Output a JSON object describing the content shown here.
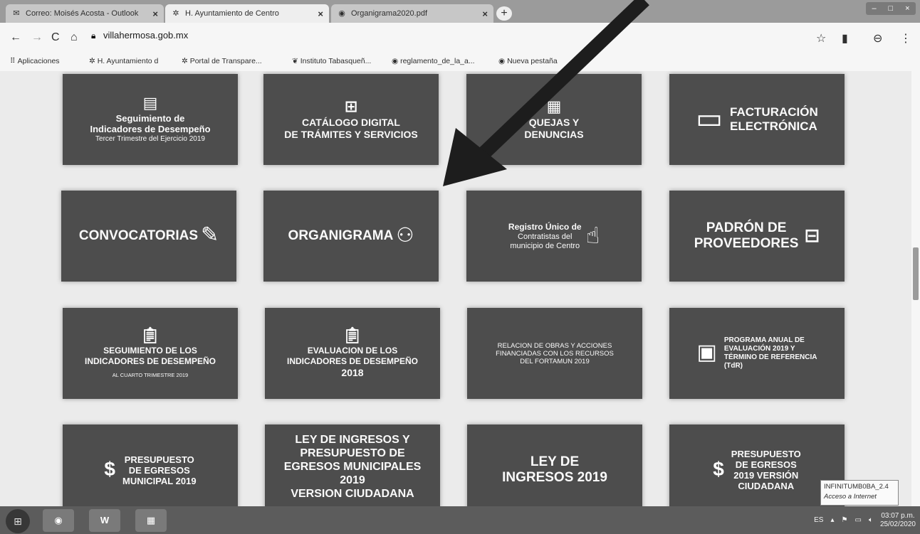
{
  "tabs": [
    {
      "label": "Correo: Moisés Acosta - Outlook",
      "icon": "outlook-icon",
      "close": "×"
    },
    {
      "label": "H. Ayuntamiento de Centro",
      "icon": "palm-icon",
      "close": "×"
    },
    {
      "label": "Organigrama2020.pdf",
      "icon": "globe-icon",
      "close": "×"
    }
  ],
  "new_tab": "+",
  "window_controls": {
    "minimize": "–",
    "maximize": "□",
    "close": "×"
  },
  "toolbar": {
    "back": "←",
    "forward": "→",
    "reload": "C",
    "home": "⌂",
    "url": "villahermosa.gob.mx",
    "star": "☆",
    "account": "⊖",
    "menu": "⋮"
  },
  "bookmarks": [
    {
      "label": "Aplicaciones",
      "icon": "apps-icon"
    },
    {
      "label": "H. Ayuntamiento d",
      "icon": "palm-icon"
    },
    {
      "label": "Portal de Transpare...",
      "icon": "palm-icon"
    },
    {
      "label": "Instituto Tabasqueñ...",
      "icon": "leaf-icon"
    },
    {
      "label": "reglamento_de_la_a...",
      "icon": "globe-icon"
    },
    {
      "label": "Nueva pestaña",
      "icon": "globe-icon"
    }
  ],
  "tiles": {
    "r1c1": {
      "l1": "Seguimiento de",
      "l2": "Indicadores de Desempeño",
      "l3": "Tercer Trimestre del Ejercicio 2019"
    },
    "r1c2": {
      "l1": "CATÁLOGO DIGITAL",
      "l2": "DE TRÁMITES Y SERVICIOS"
    },
    "r1c3": {
      "l1": "QUEJAS Y",
      "l2": "DENUNCIAS"
    },
    "r1c4": {
      "l1": "FACTURACIÓN",
      "l2": "ELECTRÓNICA"
    },
    "r2c1": {
      "l1": "CONVOCATORIAS"
    },
    "r2c2": {
      "l1": "ORGANIGRAMA"
    },
    "r2c3": {
      "l1": "Registro Único de",
      "l2": "Contratistas del",
      "l3": "municipio de Centro"
    },
    "r2c4": {
      "l1": "PADRÓN DE",
      "l2": "PROVEEDORES"
    },
    "r3c1": {
      "l1": "SEGUIMIENTO DE LOS",
      "l2": "INDICADORES DE DESEMPEÑO",
      "l3": "AL CUARTO TRIMESTRE 2019"
    },
    "r3c2": {
      "l1": "EVALUACION DE LOS",
      "l2": "INDICADORES DE DESEMPEÑO",
      "l3": "2018"
    },
    "r3c3": {
      "l1": "RELACION DE OBRAS Y ACCIONES",
      "l2": "FINANCIADAS CON LOS RECURSOS",
      "l3": "DEL FORTAMUN 2019"
    },
    "r3c4": {
      "l1": "PROGRAMA ANUAL DE",
      "l2": "EVALUACIÓN 2019 Y",
      "l3": "TÉRMINO DE REFERENCIA",
      "l4": "(TdR)"
    },
    "r4c1": {
      "l1": "PRESUPUESTO",
      "l2": "DE EGRESOS",
      "l3": "MUNICIPAL 2019"
    },
    "r4c2": {
      "l1": "LEY DE INGRESOS Y",
      "l2": "PRESUPUESTO DE",
      "l3": "EGRESOS MUNICIPALES",
      "l4": "2019",
      "l5": "VERSION CIUDADANA"
    },
    "r4c3": {
      "l1": "LEY DE",
      "l2": "INGRESOS 2019"
    },
    "r4c4": {
      "l1": "PRESUPUESTO",
      "l2": "DE EGRESOS",
      "l3": "2019 VERSIÓN",
      "l4": "CIUDADANA"
    }
  },
  "network_popup": {
    "name": "INFINITUMB0BA_2.4",
    "status": "Acceso a Internet"
  },
  "tray": {
    "lang": "ES",
    "time": "03:07 p.m.",
    "date": "25/02/2020"
  },
  "taskbar": {
    "start": "⊞",
    "word": "W"
  }
}
